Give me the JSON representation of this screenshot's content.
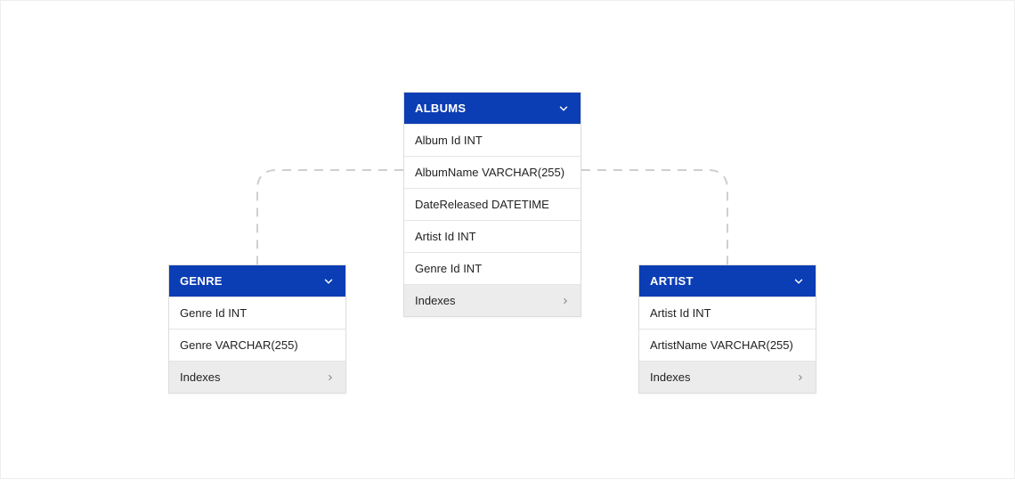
{
  "tables": {
    "genre": {
      "title": "GENRE",
      "columns": [
        "Genre Id INT",
        "Genre VARCHAR(255)"
      ],
      "indexes_label": "Indexes"
    },
    "albums": {
      "title": "ALBUMS",
      "columns": [
        "Album Id INT",
        "AlbumName VARCHAR(255)",
        "DateReleased DATETIME",
        "Artist Id INT",
        "Genre Id INT"
      ],
      "indexes_label": "Indexes"
    },
    "artist": {
      "title": "ARTIST",
      "columns": [
        "Artist Id INT",
        "ArtistName VARCHAR(255)"
      ],
      "indexes_label": "Indexes"
    }
  },
  "colors": {
    "header_bg": "#0b3db4",
    "connector": "#cfcfcf"
  }
}
